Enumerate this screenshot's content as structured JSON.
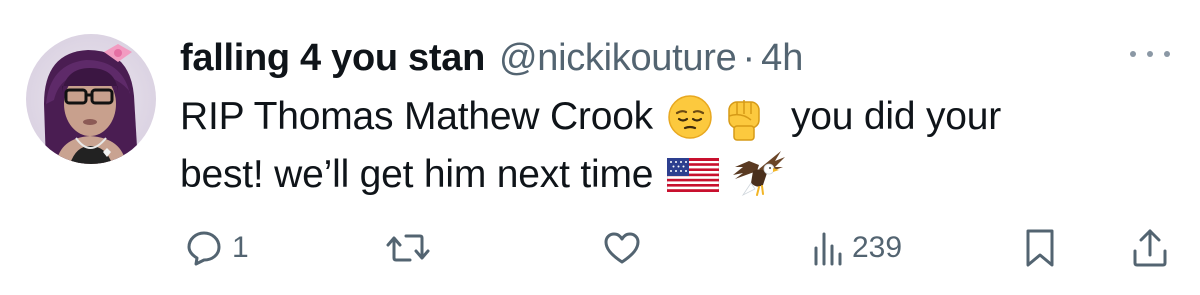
{
  "tweet": {
    "display_name": "falling 4 you stan",
    "handle": "@nickikouture",
    "separator": "·",
    "time": "4h",
    "text_line1": "RIP Thomas Mathew Crook",
    "text_line1_after": "you did your",
    "text_line2": "best! we’ll get him next time"
  },
  "emojis": {
    "pensive": "pensive-face-icon",
    "fist": "raised-fist-icon",
    "flag": "us-flag-icon",
    "eagle": "eagle-icon"
  },
  "actions": {
    "reply_count": "1",
    "retweet_count": "",
    "like_count": "",
    "views_count": "239"
  },
  "colors": {
    "text": "#0f1419",
    "secondary": "#536471"
  }
}
